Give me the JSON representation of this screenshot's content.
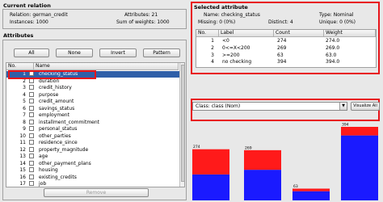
{
  "current_relation": {
    "title": "Current relation",
    "relation_label": "Relation: german_credit",
    "attributes_label": "Attributes: 21",
    "instances_label": "Instances: 1000",
    "sum_weights_label": "Sum of weights: 1000"
  },
  "attributes": {
    "title": "Attributes",
    "buttons": {
      "all": "All",
      "none": "None",
      "invert": "Invert",
      "pattern": "Pattern"
    },
    "col_no": "No.",
    "col_name": "Name",
    "rows": [
      {
        "no": "1",
        "name": "checking_status"
      },
      {
        "no": "2",
        "name": "duration"
      },
      {
        "no": "3",
        "name": "credit_history"
      },
      {
        "no": "4",
        "name": "purpose"
      },
      {
        "no": "5",
        "name": "credit_amount"
      },
      {
        "no": "6",
        "name": "savings_status"
      },
      {
        "no": "7",
        "name": "employment"
      },
      {
        "no": "8",
        "name": "installment_commitment"
      },
      {
        "no": "9",
        "name": "personal_status"
      },
      {
        "no": "10",
        "name": "other_parties"
      },
      {
        "no": "11",
        "name": "residence_since"
      },
      {
        "no": "12",
        "name": "property_magnitude"
      },
      {
        "no": "13",
        "name": "age"
      },
      {
        "no": "14",
        "name": "other_payment_plans"
      },
      {
        "no": "15",
        "name": "housing"
      },
      {
        "no": "16",
        "name": "existing_credits"
      },
      {
        "no": "17",
        "name": "job"
      }
    ],
    "remove_label": "Remove"
  },
  "selected_attribute": {
    "title": "Selected attribute",
    "name_label": "Name: checking_status",
    "type_label": "Type: Nominal",
    "missing_label": "Missing: 0 (0%)",
    "distinct_label": "Distinct: 4",
    "unique_label": "Unique: 0 (0%)",
    "col_no": "No.",
    "col_label": "Label",
    "col_count": "Count",
    "col_weight": "Weight",
    "rows": [
      {
        "no": "1",
        "label": "<0",
        "count": "274",
        "weight": "274.0"
      },
      {
        "no": "2",
        "label": "0<=X<200",
        "count": "269",
        "weight": "269.0"
      },
      {
        "no": "3",
        "label": ">=200",
        "count": "63",
        "weight": "63.0"
      },
      {
        "no": "4",
        "label": "no checking",
        "count": "394",
        "weight": "394.0"
      }
    ]
  },
  "class_select": {
    "value": "Class: class (Nom)",
    "visualize_label": "Visualize All"
  },
  "chart_data": {
    "type": "bar",
    "categories": [
      "<0",
      "0<=X<200",
      ">=200",
      "no checking"
    ],
    "series": [
      {
        "values": [
          139,
          164,
          49,
          348
        ],
        "color": "#1a1aff"
      },
      {
        "values": [
          135,
          105,
          14,
          46
        ],
        "color": "#ff1a1a"
      }
    ],
    "totals": [
      "274",
      "269",
      "63",
      "394"
    ],
    "ylim": [
      0,
      394
    ]
  },
  "colors": {
    "highlight": "#e8141a",
    "selection": "#2f5fa8"
  }
}
